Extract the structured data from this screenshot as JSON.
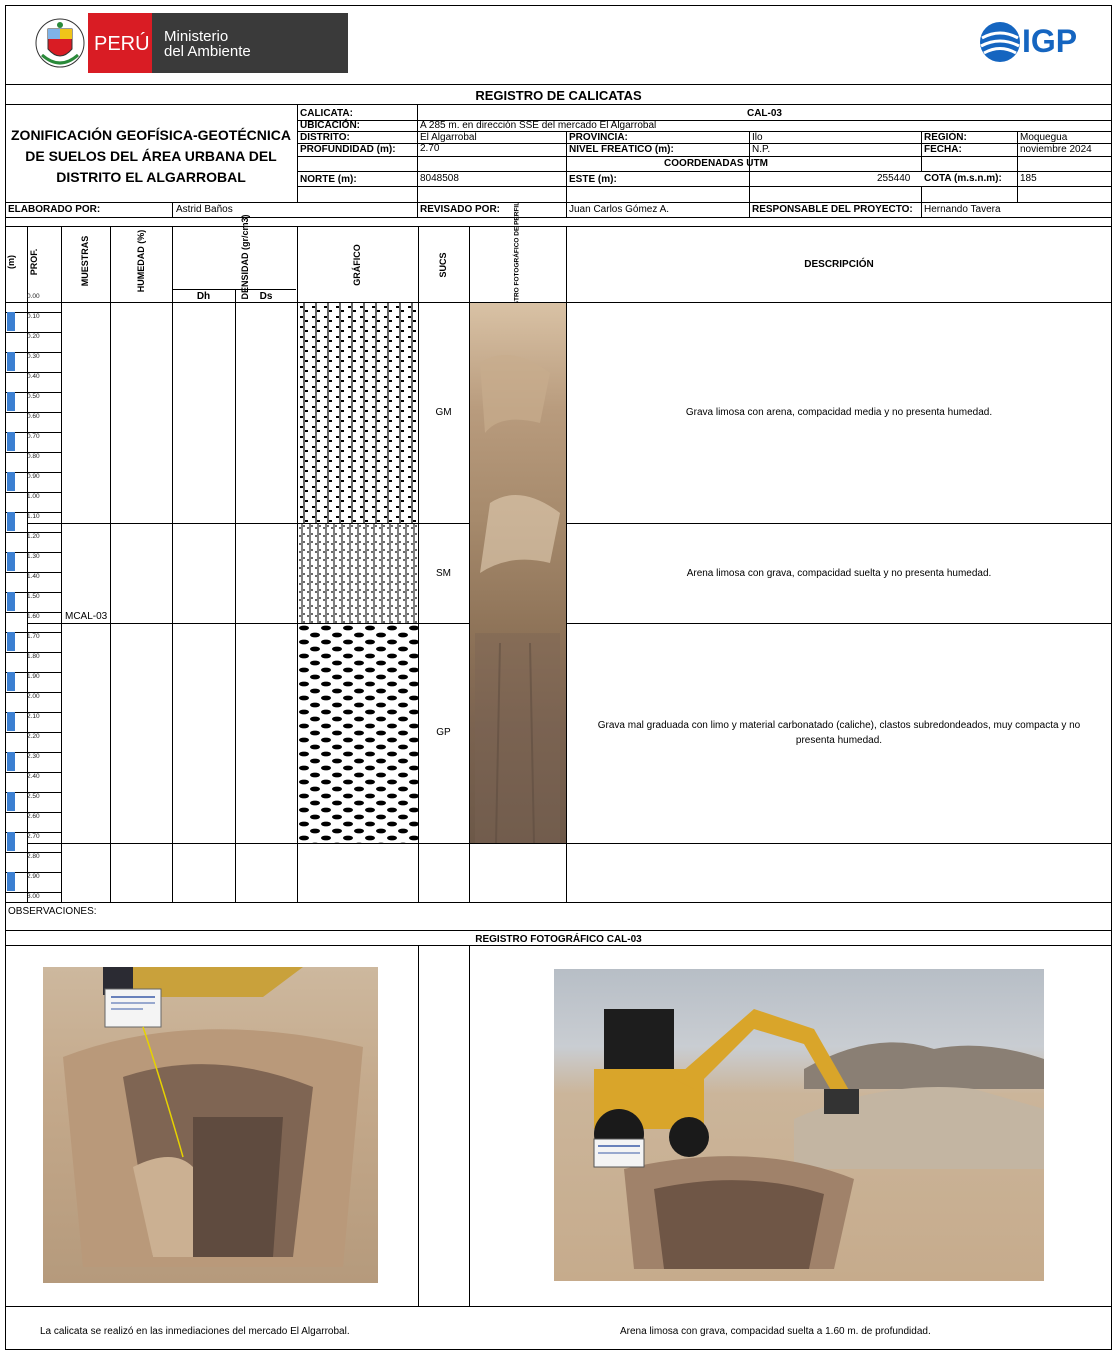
{
  "header": {
    "peru_label": "PERÚ",
    "ministry_line1": "Ministerio",
    "ministry_line2": "del Ambiente",
    "igp_label": "IGP"
  },
  "sheet_title": "REGISTRO DE CALICATAS",
  "project_title": [
    "ZONIFICACIÓN GEOFÍSICA-GEOTÉCNICA",
    "DE SUELOS DEL ÁREA URBANA DEL",
    "DISTRITO EL ALGARROBAL"
  ],
  "info": {
    "calicata_label": "CALICATA:",
    "calicata_value": "CAL-03",
    "ubicacion_label": "UBICACIÓN:",
    "ubicacion_value": "A 285 m. en dirección SSE del mercado El Algarrobal",
    "distrito_label": "DISTRITO:",
    "distrito_value": "El Algarrobal",
    "provincia_label": "PROVINCIA:",
    "provincia_value": "Ilo",
    "region_label": "REGIÓN:",
    "region_value": "Moquegua",
    "profundidad_label": "PROFUNDIDAD (m):",
    "profundidad_value": "2.70",
    "nivel_label": "NIVEL FREÁTICO (m):",
    "nivel_value": "N.P.",
    "fecha_label": "FECHA:",
    "fecha_value": "noviembre 2024",
    "coordenadas_label": "COORDENADAS UTM",
    "norte_label": "NORTE (m):",
    "norte_value": "8048508",
    "este_label": "ESTE (m):",
    "este_value": "255440",
    "cota_label": "COTA (m.s.n.m):",
    "cota_value": "185",
    "elaborado_label": "ELABORADO POR:",
    "elaborado_value": "Astrid Baños",
    "revisado_label": "REVISADO POR:",
    "revisado_value": "Juan Carlos Gómez A.",
    "responsable_label": "RESPONSABLE DEL PROYECTO:",
    "responsable_value": "Hernando Tavera"
  },
  "columns": {
    "m": "(m)",
    "prof": "PROF.",
    "muestras": "MUESTRAS",
    "humedad": "HUMEDAD (%)",
    "densidad": "DENSIDAD (gr/cm3)",
    "dh": "Dh",
    "ds": "Ds",
    "grafico": "GRÁFICO",
    "sucs": "SUCS",
    "registro": "REGISTRO FOTOGRÁFICO DE PERFIL",
    "descripcion": "DESCRIPCIÓN"
  },
  "depths": [
    "0.00",
    "0.10",
    "0.20",
    "0.30",
    "0.40",
    "0.50",
    "0.60",
    "0.70",
    "0.80",
    "0.90",
    "1.00",
    "1.10",
    "1.20",
    "1.30",
    "1.40",
    "1.50",
    "1.60",
    "1.70",
    "1.80",
    "1.90",
    "2.00",
    "2.10",
    "2.20",
    "2.30",
    "2.40",
    "2.50",
    "2.60",
    "2.70",
    "2.80",
    "2.90",
    "3.00"
  ],
  "sample": "MCAL-03",
  "layers": [
    {
      "sucs": "GM",
      "description": "Grava limosa con arena, compacidad media y no presenta humedad."
    },
    {
      "sucs": "SM",
      "description": "Arena limosa con grava, compacidad suelta y no presenta humedad."
    },
    {
      "sucs": "GP",
      "description_line1": "Grava mal graduada con limo y material carbonatado (caliche), clastos subredondeados, muy compacta y no",
      "description_line2": "presenta humedad."
    }
  ],
  "observaciones_label": "OBSERVACIONES:",
  "photo_section_title": "REGISTRO FOTOGRÁFICO CAL-03",
  "captions": {
    "left": "La calicata se realizó en las inmediaciones del mercado El Algarrobal.",
    "right": "Arena limosa con grava, compacidad suelta a 1.60 m. de profundidad."
  },
  "colors": {
    "depth_blue": "#3b7fd1",
    "peru_red": "#d91c24",
    "igp_blue": "#1565c0"
  }
}
